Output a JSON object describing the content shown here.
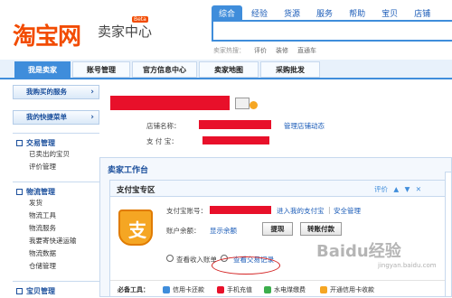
{
  "header": {
    "logo_text": "淘宝网",
    "logo_sub": "卖家中心",
    "beta": "Beta",
    "search_tabs": [
      "综合",
      "经验",
      "货源",
      "服务",
      "帮助",
      "宝贝",
      "店铺"
    ],
    "hot_label": "卖家热搜：",
    "hot_words": [
      "评价",
      "装修",
      "直通车"
    ]
  },
  "nav": {
    "items": [
      "我是卖家",
      "账号管理",
      "官方信息中心",
      "卖家地图",
      "采购批发"
    ]
  },
  "sidebar": {
    "btn_services": "我购买的服务",
    "btn_shortcuts": "我的快捷菜单",
    "sections": [
      {
        "title": "交易管理",
        "items": [
          "已卖出的宝贝",
          "评价管理"
        ]
      },
      {
        "title": "物流管理",
        "items": [
          "发货",
          "物流工具",
          "物流服务",
          "我要寄快递运输",
          "物流数据",
          "仓储管理"
        ]
      },
      {
        "title": "宝贝管理",
        "items": []
      }
    ]
  },
  "shop_info": {
    "shop_name_label": "店铺名称：",
    "manage_link": "管理店铺动态",
    "alipay_label": "支 付 宝："
  },
  "workbench": {
    "title": "卖家工作台",
    "alipay_zone": {
      "title": "支付宝专区",
      "controls": [
        "评价",
        "▲",
        "▼",
        "✕"
      ],
      "account_label": "支付宝账号：",
      "enter_link": "进入我的支付宝",
      "separator": "|",
      "security_link": "安全管理",
      "balance_label": "账户余额：",
      "show_balance": "显示余额",
      "withdraw_btn": "提现",
      "transfer_btn": "转账付款",
      "income_link": "查看收入账单",
      "records_link": "查看交易记录",
      "tools_label": "必备工具：",
      "tools": [
        "信用卡还款",
        "手机充值",
        "水电煤缴费",
        "开通信用卡收款"
      ]
    }
  },
  "watermark": {
    "text": "Baidu经验",
    "url": "jingyan.baidu.com"
  },
  "colors": {
    "brand_orange": "#f24b00",
    "link_blue": "#1b5cb8",
    "nav_blue": "#3f8ddb",
    "redaction": "#e8102a"
  }
}
